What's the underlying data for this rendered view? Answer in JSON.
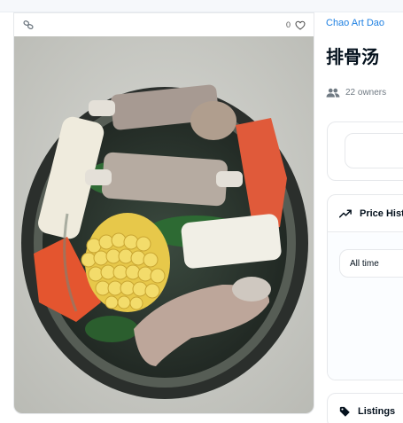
{
  "item": {
    "likes_count": "0",
    "collection_name": "Chao Art Dao",
    "title": "排骨汤",
    "owners_text": "22 owners"
  },
  "price_history": {
    "label": "Price Hist",
    "period_select": "All time"
  },
  "listings": {
    "label": "Listings"
  },
  "icons": {
    "chain": "chain-link-icon",
    "like": "heart-icon",
    "owners": "people-icon",
    "price_history": "trending-up-icon",
    "listings": "tag-icon"
  },
  "colors": {
    "accent_link": "#2081e2",
    "text_primary": "#04111d",
    "text_secondary": "#707a83",
    "border": "#e6e8eb"
  }
}
